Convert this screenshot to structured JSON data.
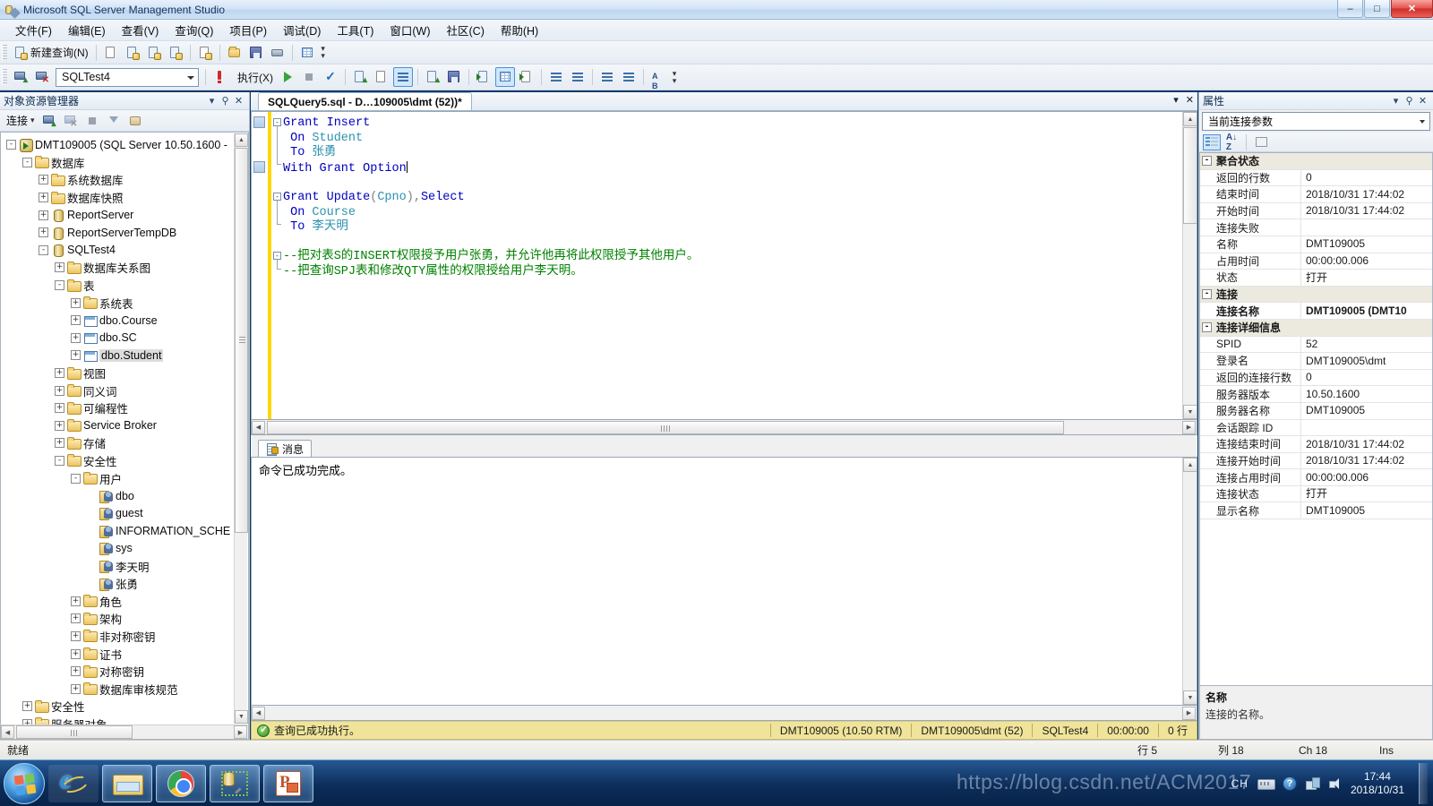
{
  "window": {
    "title": "Microsoft SQL Server Management Studio",
    "app_icon": "ssms-icon",
    "minimize": "–",
    "maximize": "□",
    "close": "✕"
  },
  "menu": {
    "items": [
      {
        "label": "文件(F)",
        "name": "menu-file"
      },
      {
        "label": "编辑(E)",
        "name": "menu-edit"
      },
      {
        "label": "查看(V)",
        "name": "menu-view"
      },
      {
        "label": "查询(Q)",
        "name": "menu-query"
      },
      {
        "label": "项目(P)",
        "name": "menu-project"
      },
      {
        "label": "调试(D)",
        "name": "menu-debug"
      },
      {
        "label": "工具(T)",
        "name": "menu-tools"
      },
      {
        "label": "窗口(W)",
        "name": "menu-window"
      },
      {
        "label": "社区(C)",
        "name": "menu-community"
      },
      {
        "label": "帮助(H)",
        "name": "menu-help"
      }
    ]
  },
  "toolbar_standard": {
    "new_query_label": "新建查询(N)"
  },
  "toolbar_editor": {
    "database_combo_value": "SQLTest4",
    "execute_label": "执行(X)"
  },
  "object_explorer": {
    "title": "对象资源管理器",
    "connect_label": "连接",
    "tree": [
      {
        "label": "DMT109005 (SQL Server 10.50.1600 -",
        "indent": 0,
        "expander": "-",
        "icon": "server-icon"
      },
      {
        "label": "数据库",
        "indent": 1,
        "expander": "-",
        "icon": "folder-icon"
      },
      {
        "label": "系统数据库",
        "indent": 2,
        "expander": "+",
        "icon": "folder-icon"
      },
      {
        "label": "数据库快照",
        "indent": 2,
        "expander": "+",
        "icon": "folder-icon"
      },
      {
        "label": "ReportServer",
        "indent": 2,
        "expander": "+",
        "icon": "database-icon"
      },
      {
        "label": "ReportServerTempDB",
        "indent": 2,
        "expander": "+",
        "icon": "database-icon"
      },
      {
        "label": "SQLTest4",
        "indent": 2,
        "expander": "-",
        "icon": "database-icon"
      },
      {
        "label": "数据库关系图",
        "indent": 3,
        "expander": "+",
        "icon": "folder-icon"
      },
      {
        "label": "表",
        "indent": 3,
        "expander": "-",
        "icon": "folder-icon"
      },
      {
        "label": "系统表",
        "indent": 4,
        "expander": "+",
        "icon": "folder-icon"
      },
      {
        "label": "dbo.Course",
        "indent": 4,
        "expander": "+",
        "icon": "table-icon"
      },
      {
        "label": "dbo.SC",
        "indent": 4,
        "expander": "+",
        "icon": "table-icon"
      },
      {
        "label": "dbo.Student",
        "indent": 4,
        "expander": "+",
        "icon": "table-icon",
        "selected": true
      },
      {
        "label": "视图",
        "indent": 3,
        "expander": "+",
        "icon": "folder-icon"
      },
      {
        "label": "同义词",
        "indent": 3,
        "expander": "+",
        "icon": "folder-icon"
      },
      {
        "label": "可编程性",
        "indent": 3,
        "expander": "+",
        "icon": "folder-icon"
      },
      {
        "label": "Service Broker",
        "indent": 3,
        "expander": "+",
        "icon": "folder-icon"
      },
      {
        "label": "存储",
        "indent": 3,
        "expander": "+",
        "icon": "folder-icon"
      },
      {
        "label": "安全性",
        "indent": 3,
        "expander": "-",
        "icon": "folder-icon"
      },
      {
        "label": "用户",
        "indent": 4,
        "expander": "-",
        "icon": "folder-icon"
      },
      {
        "label": "dbo",
        "indent": 5,
        "expander": "",
        "icon": "user-icon"
      },
      {
        "label": "guest",
        "indent": 5,
        "expander": "",
        "icon": "user-icon"
      },
      {
        "label": "INFORMATION_SCHE",
        "indent": 5,
        "expander": "",
        "icon": "user-icon"
      },
      {
        "label": "sys",
        "indent": 5,
        "expander": "",
        "icon": "user-icon"
      },
      {
        "label": "李天明",
        "indent": 5,
        "expander": "",
        "icon": "user-icon"
      },
      {
        "label": "张勇",
        "indent": 5,
        "expander": "",
        "icon": "user-icon"
      },
      {
        "label": "角色",
        "indent": 4,
        "expander": "+",
        "icon": "folder-icon"
      },
      {
        "label": "架构",
        "indent": 4,
        "expander": "+",
        "icon": "folder-icon"
      },
      {
        "label": "非对称密钥",
        "indent": 4,
        "expander": "+",
        "icon": "folder-icon"
      },
      {
        "label": "证书",
        "indent": 4,
        "expander": "+",
        "icon": "folder-icon"
      },
      {
        "label": "对称密钥",
        "indent": 4,
        "expander": "+",
        "icon": "folder-icon"
      },
      {
        "label": "数据库审核规范",
        "indent": 4,
        "expander": "+",
        "icon": "folder-icon"
      },
      {
        "label": "安全性",
        "indent": 1,
        "expander": "+",
        "icon": "folder-icon"
      },
      {
        "label": "服务器对象",
        "indent": 1,
        "expander": "+",
        "icon": "folder-icon"
      }
    ]
  },
  "editor": {
    "tab_label": "SQLQuery5.sql - D…109005\\dmt (52))*",
    "code_lines": [
      {
        "type": "sql",
        "tokens": [
          {
            "t": "Grant Insert",
            "c": "kw"
          }
        ]
      },
      {
        "type": "sql",
        "tokens": [
          {
            "t": " On ",
            "c": "kw"
          },
          {
            "t": "Student",
            "c": "tbl"
          }
        ]
      },
      {
        "type": "sql",
        "tokens": [
          {
            "t": " To ",
            "c": "kw"
          },
          {
            "t": "张勇",
            "c": "tbl"
          }
        ]
      },
      {
        "type": "sql",
        "tokens": [
          {
            "t": "With Grant Option",
            "c": "kw"
          }
        ],
        "caret": true
      },
      {
        "type": "blank",
        "tokens": []
      },
      {
        "type": "sql",
        "tokens": [
          {
            "t": "Grant Update",
            "c": "kw"
          },
          {
            "t": "(",
            "c": "punct"
          },
          {
            "t": "Cpno",
            "c": "tbl"
          },
          {
            "t": ")",
            "c": "punct"
          },
          {
            "t": ",",
            "c": "punct"
          },
          {
            "t": "Select",
            "c": "kw"
          }
        ]
      },
      {
        "type": "sql",
        "tokens": [
          {
            "t": " On ",
            "c": "kw"
          },
          {
            "t": "Course",
            "c": "tbl"
          }
        ]
      },
      {
        "type": "sql",
        "tokens": [
          {
            "t": " To ",
            "c": "kw"
          },
          {
            "t": "李天明",
            "c": "tbl"
          }
        ]
      },
      {
        "type": "blank",
        "tokens": []
      },
      {
        "type": "comment",
        "tokens": [
          {
            "t": "--把对表S的INSERT权限授予用户张勇，并允许他再将此权限授予其他用户。",
            "c": "cmt"
          }
        ]
      },
      {
        "type": "comment",
        "tokens": [
          {
            "t": "--把查询SPJ表和修改QTY属性的权限授给用户李天明。",
            "c": "cmt"
          }
        ]
      }
    ]
  },
  "results": {
    "tab_label": "消息",
    "message_text": "命令已成功完成。"
  },
  "query_status": {
    "status_text": "查询已成功执行。",
    "server": "DMT109005 (10.50 RTM)",
    "login": "DMT109005\\dmt (52)",
    "database": "SQLTest4",
    "elapsed": "00:00:00",
    "rows": "0 行"
  },
  "properties": {
    "title": "属性",
    "combo_value": "当前连接参数",
    "rows": [
      {
        "kind": "category",
        "name": "聚合状态",
        "expander": "-"
      },
      {
        "kind": "prop",
        "name": "返回的行数",
        "value": "0"
      },
      {
        "kind": "prop",
        "name": "结束时间",
        "value": "2018/10/31 17:44:02"
      },
      {
        "kind": "prop",
        "name": "开始时间",
        "value": "2018/10/31 17:44:02"
      },
      {
        "kind": "prop",
        "name": "连接失败",
        "value": ""
      },
      {
        "kind": "prop",
        "name": "名称",
        "value": "DMT109005"
      },
      {
        "kind": "prop",
        "name": "占用时间",
        "value": "00:00:00.006"
      },
      {
        "kind": "prop",
        "name": "状态",
        "value": "打开"
      },
      {
        "kind": "category",
        "name": "连接",
        "expander": "-"
      },
      {
        "kind": "prop",
        "name": "连接名称",
        "value": "DMT109005 (DMT10",
        "bold": true
      },
      {
        "kind": "category",
        "name": "连接详细信息",
        "expander": "-"
      },
      {
        "kind": "prop",
        "name": "SPID",
        "value": "52"
      },
      {
        "kind": "prop",
        "name": "登录名",
        "value": "DMT109005\\dmt"
      },
      {
        "kind": "prop",
        "name": "返回的连接行数",
        "value": "0"
      },
      {
        "kind": "prop",
        "name": "服务器版本",
        "value": "10.50.1600"
      },
      {
        "kind": "prop",
        "name": "服务器名称",
        "value": "DMT109005"
      },
      {
        "kind": "prop",
        "name": "会话跟踪 ID",
        "value": ""
      },
      {
        "kind": "prop",
        "name": "连接结束时间",
        "value": "2018/10/31 17:44:02"
      },
      {
        "kind": "prop",
        "name": "连接开始时间",
        "value": "2018/10/31 17:44:02"
      },
      {
        "kind": "prop",
        "name": "连接占用时间",
        "value": "00:00:00.006"
      },
      {
        "kind": "prop",
        "name": "连接状态",
        "value": "打开"
      },
      {
        "kind": "prop",
        "name": "显示名称",
        "value": "DMT109005"
      }
    ],
    "description_title": "名称",
    "description_text": "连接的名称。"
  },
  "ide_status": {
    "ready": "就绪",
    "line": "行 5",
    "column": "列 18",
    "char": "Ch 18",
    "insert_mode": "Ins"
  },
  "taskbar": {
    "start": "start-orb",
    "items": [
      {
        "name": "taskbar-ie",
        "icon": "internet-explorer-icon",
        "state": "pinned"
      },
      {
        "name": "taskbar-explorer",
        "icon": "folder-explorer-icon",
        "state": "running"
      },
      {
        "name": "taskbar-chrome",
        "icon": "chrome-icon",
        "state": "running"
      },
      {
        "name": "taskbar-ssms",
        "icon": "sql-server-management-studio-icon",
        "state": "running"
      },
      {
        "name": "taskbar-powerpoint",
        "icon": "powerpoint-icon",
        "state": "running"
      }
    ],
    "tray": {
      "ime": "CH",
      "time": "17:44",
      "date": "2018/10/31"
    },
    "watermark": "https://blog.csdn.net/ACM2017"
  }
}
